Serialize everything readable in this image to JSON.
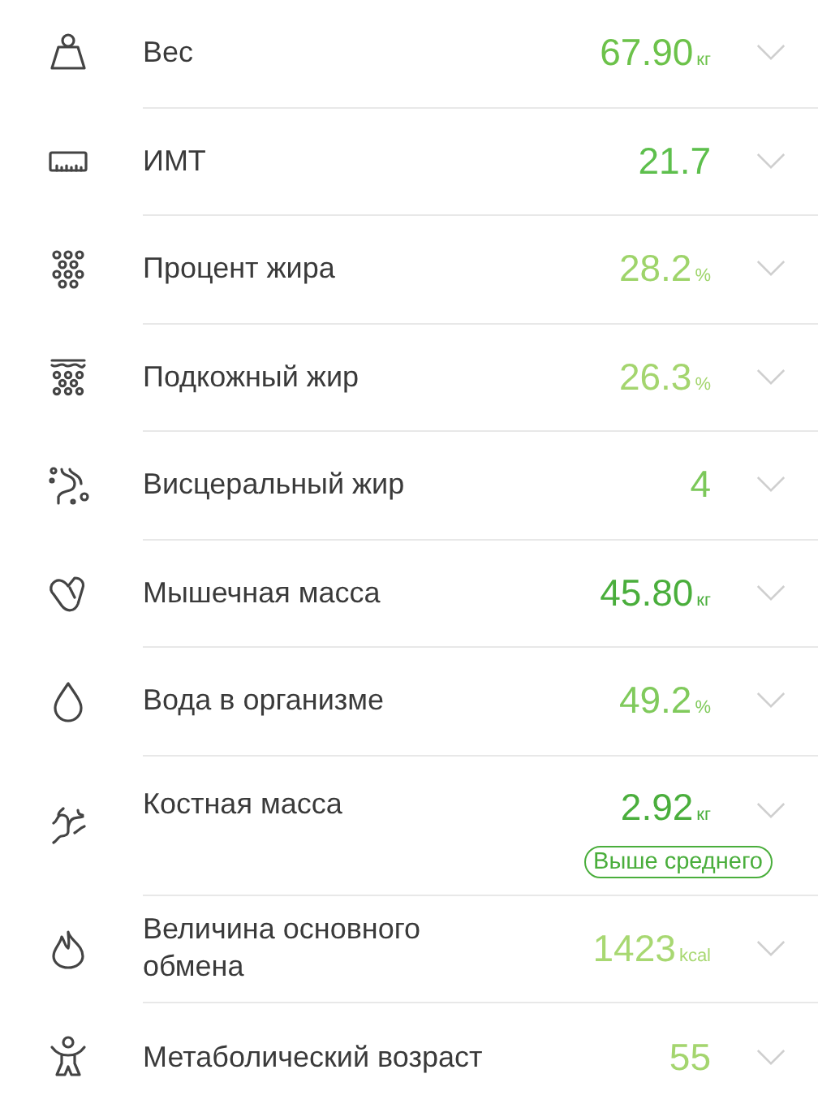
{
  "metrics": [
    {
      "label": "Вес",
      "value": "67.90",
      "unit": "кг",
      "color": "#6cc24a"
    },
    {
      "label": "ИМТ",
      "value": "21.7",
      "color": "#5dbf4c"
    },
    {
      "label": "Процент жира",
      "value": "28.2",
      "unit": "%",
      "color": "#9ed46a"
    },
    {
      "label": "Подкожный жир",
      "value": "26.3",
      "unit": "%",
      "color": "#a4d56e"
    },
    {
      "label": "Висцеральный жир",
      "value": "4",
      "color": "#7cc85a"
    },
    {
      "label": "Мышечная масса",
      "value": "45.80",
      "unit": "кг",
      "color": "#4aae3c"
    },
    {
      "label": "Вода в организме",
      "value": "49.2",
      "unit": "%",
      "color": "#80ca5c"
    },
    {
      "label": "Костная масса",
      "value": "2.92",
      "unit": "кг",
      "color": "#4aae3c",
      "badge": "Выше среднего"
    },
    {
      "label": "Величина основного обмена",
      "value": "1423",
      "unit": "kcal",
      "color": "#a8d872"
    },
    {
      "label": "Метаболический возраст",
      "value": "55",
      "color": "#a4d56e"
    }
  ]
}
